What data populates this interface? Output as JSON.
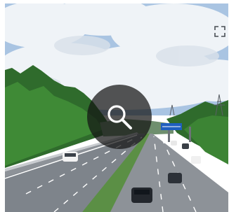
{
  "image": {
    "alt": "",
    "sign_color": "#1f5fbf"
  },
  "overlay": {
    "icon": "search-icon",
    "color": "#ffffff"
  },
  "corner": {
    "icon": "expand-icon"
  }
}
